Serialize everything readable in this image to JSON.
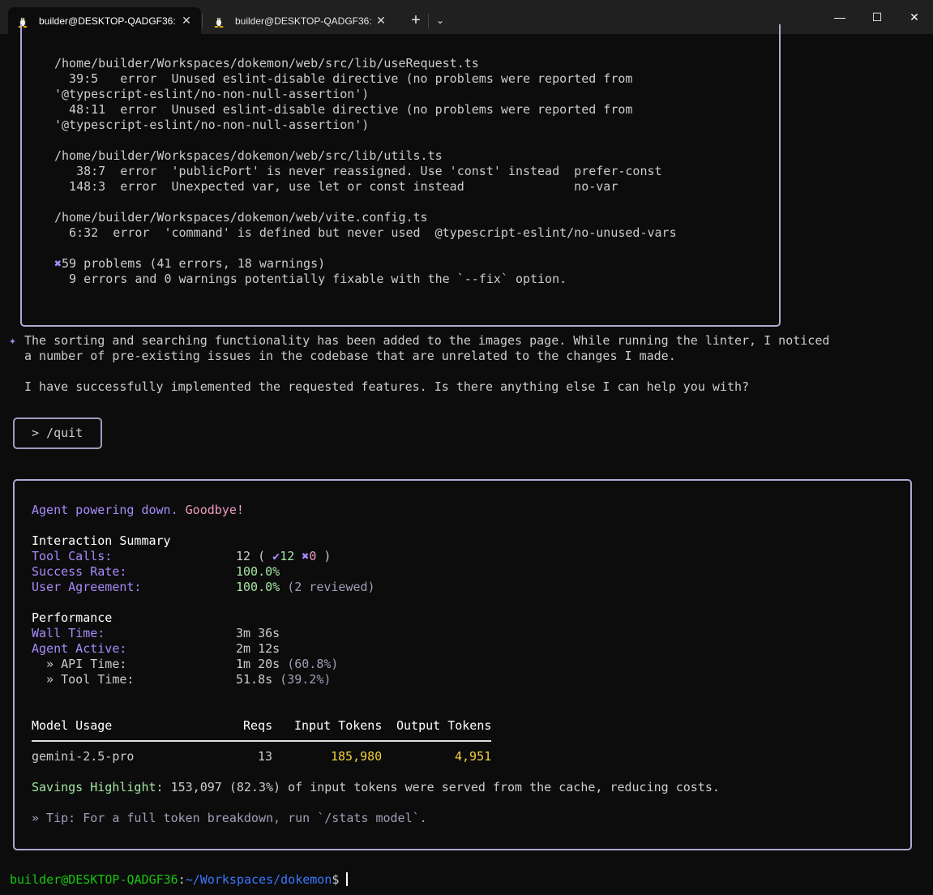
{
  "window": {
    "tabs": [
      {
        "title": "builder@DESKTOP-QADGF36:",
        "close": "✕"
      },
      {
        "title": "builder@DESKTOP-QADGF36:",
        "close": "✕"
      }
    ],
    "new_tab": "+",
    "dropdown": "⌄",
    "minimize": "—",
    "maximize": "☐",
    "close": "✕"
  },
  "lint": {
    "file1": "/home/builder/Workspaces/dokemon/web/src/lib/useRequest.ts",
    "f1_l1": "  39:5   error  Unused eslint-disable directive (no problems were reported from",
    "f1_l2": "'@typescript-eslint/no-non-null-assertion')",
    "f1_l3": "  48:11  error  Unused eslint-disable directive (no problems were reported from",
    "f1_l4": "'@typescript-eslint/no-non-null-assertion')",
    "file2": "/home/builder/Workspaces/dokemon/web/src/lib/utils.ts",
    "f2_l1": "   38:7  error  'publicPort' is never reassigned. Use 'const' instead  prefer-const",
    "f2_l2": "  148:3  error  Unexpected var, use let or const instead               no-var",
    "file3": "/home/builder/Workspaces/dokemon/web/vite.config.ts",
    "f3_l1": "  6:32  error  'command' is defined but never used  @typescript-eslint/no-unused-vars",
    "problems_icon": "✖",
    "problems": "59 problems (41 errors, 18 warnings)",
    "fixable": "  9 errors and 0 warnings potentially fixable with the `--fix` option."
  },
  "message": {
    "icon": "✦",
    "line1": "The sorting and searching functionality has been added to the images page. While running the linter, I noticed",
    "line2": "a number of pre-existing issues in the codebase that are unrelated to the changes I made.",
    "line3": "I have successfully implemented the requested features. Is there anything else I can help you with?"
  },
  "input": {
    "text": "> /quit"
  },
  "summary": {
    "powering": "Agent powering down.",
    "goodbye": "Goodbye!",
    "interaction_heading": "Interaction Summary",
    "tool_calls_label": "Tool Calls:",
    "tool_calls_value": "12 ( ",
    "success_icon": "✔",
    "success_count": "12",
    "fail_icon": "✖",
    "fail_count": "0",
    "tool_calls_close": " )",
    "success_rate_label": "Success Rate:",
    "success_rate_value": "100.0%",
    "agreement_label": "User Agreement:",
    "agreement_value": "100.0%",
    "agreement_note": " (2 reviewed)",
    "performance_heading": "Performance",
    "wall_label": "Wall Time:",
    "wall_value": "3m 36s",
    "active_label": "Agent Active:",
    "active_value": "2m 12s",
    "api_label": "  » API Time:",
    "api_value": "1m 20s",
    "api_pct": " (60.8%)",
    "tool_label": "  » Tool Time:",
    "tool_value": "51.8s",
    "tool_pct": " (39.2%)",
    "model_heading": "Model Usage",
    "reqs_heading": "Reqs",
    "input_heading": "Input Tokens",
    "output_heading": "Output Tokens",
    "model_name": "gemini-2.5-pro",
    "model_reqs": "13",
    "model_input": "185,980",
    "model_output": "4,951",
    "savings_label": "Savings Highlight:",
    "savings_text": " 153,097 (82.3%) of input tokens were served from the cache, reducing costs.",
    "tip": "» Tip: For a full token breakdown, run `/stats model`."
  },
  "prompt": {
    "user_host": "builder@DESKTOP-QADGF36",
    "colon": ":",
    "path": "~/Workspaces/dokemon",
    "dollar": "$ "
  },
  "colors": {
    "border": "#b0a9d4",
    "accent_purple": "#a78bfa",
    "pink": "#f09bc0",
    "green": "#a3e6a0",
    "yellow": "#f1d03c",
    "prompt_green": "#16c60c",
    "prompt_blue": "#3b78ff"
  }
}
